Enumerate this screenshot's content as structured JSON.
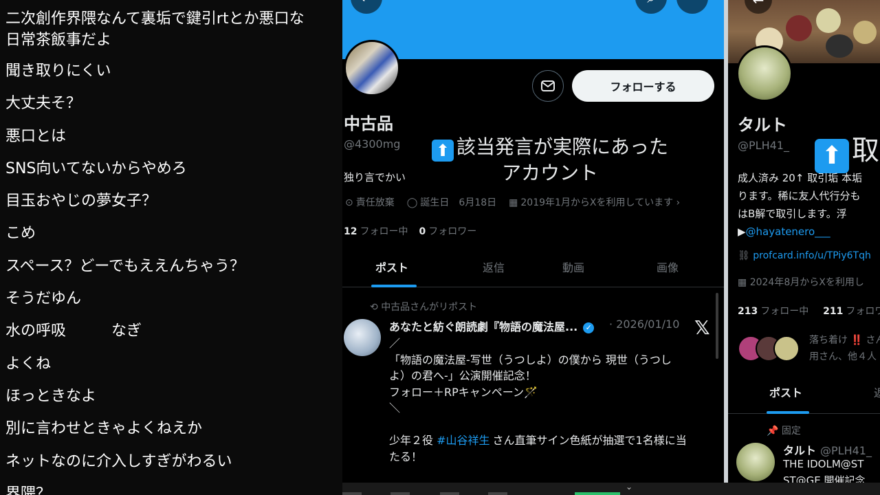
{
  "chat": {
    "lines": [
      "二次創作界隈なんて裏垢で鍵引rtとか悪口な",
      "日常茶飯事だよ",
      "聞き取りにくい",
      "大丈夫そ？",
      "悪口とは",
      "SNS向いてないからやめろ",
      "目玉おやじの夢女子？",
      "こめ",
      "スペース？どーでもええんちゃう？",
      "そうだゆん",
      "水の呼吸　　　なぎ",
      "よくね",
      "ほっときなよ",
      "別に言わせときゃよくねえか",
      "ネットなのに介入しすぎがわるい",
      "界隈？"
    ]
  },
  "profile1": {
    "follow_button": "フォローする",
    "display_name": "中古品",
    "handle": "@4300mg",
    "caption": "該当発言が実際にあった\nアカウント",
    "bio": "独り言でかい",
    "meta": {
      "location": "責任放棄",
      "birthday": "誕生日　6月18日",
      "joined": "2019年1月からXを利用しています"
    },
    "following_count": "12",
    "following_label": "フォロー中",
    "followers_count": "0",
    "followers_label": "フォロワー",
    "tabs": [
      "ポスト",
      "返信",
      "動画",
      "画像"
    ],
    "post": {
      "repost_note": "中古品さんがリポスト",
      "author": "あなたと紡ぐ朗読劇『物語の魔法屋...",
      "date": "· 2026/01/10",
      "body_lines": [
        "／",
        "「物語の魔法屋-写世（うつしよ）の僕から 現世（うつし",
        "よ）の君へ-」公演開催記念！",
        "フォロー＋RPキャンペーン🪄",
        "＼",
        "",
        "少年２役 ",
        "さん直筆サイン色紙が抽選で1名様に当",
        "たる！"
      ],
      "hashtag": "#山谷祥生"
    }
  },
  "profile2": {
    "display_name": "タルト",
    "handle": "@PLH41_",
    "caption": "取",
    "bio_lines": [
      "成人済み 20↑ 取引垢 本垢",
      "ります。稀に友人代行分も",
      "はB解で取引します。浮"
    ],
    "bio_link_prefix": "▶",
    "bio_link": "@hayatenero___",
    "profcard": "profcard.info/u/TPiy6Tqh",
    "joined": "2024年8月からXを利用し",
    "following_count": "213",
    "following_label": "フォロー中",
    "followers_count": "211",
    "followers_label": "フォロワ",
    "known_line1": "落ち着け ‼️ さん",
    "known_line2": "用さん、他４人",
    "tab_posts": "ポスト",
    "tab_next": "返",
    "pinned": "固定",
    "post_author": "タルト",
    "post_handle": "@PLH41_",
    "post_line1": "THE IDOLM@ST",
    "post_line2": "ST@GE 開催記念"
  },
  "icons": {
    "back": "arrow-left-icon",
    "search": "search-icon",
    "more": "more-icon",
    "mail": "mail-icon",
    "location": "location-icon",
    "birthday": "balloon-icon",
    "calendar": "calendar-icon",
    "repost": "repost-icon",
    "verified": "verified-badge-icon",
    "x_logo": "x-logo-icon",
    "pin": "pin-icon",
    "link": "link-icon"
  },
  "colors": {
    "accent": "#1d9bf0",
    "background": "#000000",
    "muted": "#71767b"
  }
}
